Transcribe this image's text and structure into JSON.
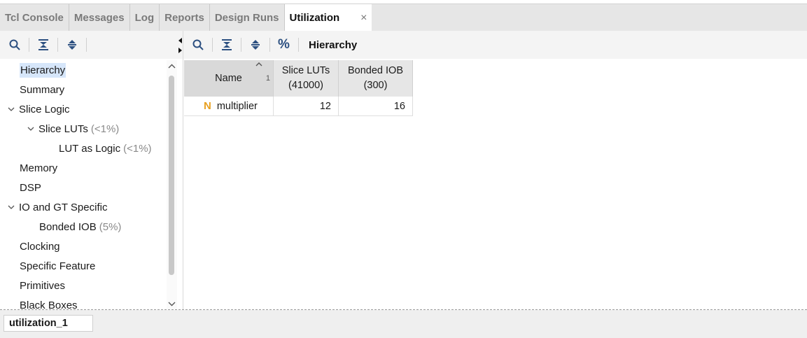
{
  "tabs": [
    {
      "label": "Tcl Console",
      "active": false
    },
    {
      "label": "Messages",
      "active": false
    },
    {
      "label": "Log",
      "active": false
    },
    {
      "label": "Reports",
      "active": false
    },
    {
      "label": "Design Runs",
      "active": false
    },
    {
      "label": "Utilization",
      "active": true
    }
  ],
  "tab_close_glyph": "×",
  "left_toolbar": {
    "icons": [
      "search-icon",
      "collapse-all-icon",
      "expand-all-icon"
    ]
  },
  "right_toolbar": {
    "icons": [
      "search-icon",
      "collapse-all-icon",
      "expand-all-icon",
      "percent-icon"
    ],
    "percent_glyph": "%",
    "title": "Hierarchy"
  },
  "tree": {
    "items": [
      {
        "label": "Hierarchy",
        "pct": "",
        "selected": true
      },
      {
        "label": "Summary",
        "pct": ""
      },
      {
        "label": "Slice Logic",
        "pct": "",
        "expanded": true
      },
      {
        "label": "Slice LUTs",
        "pct": "(<1%)",
        "expanded": true
      },
      {
        "label": "LUT as Logic",
        "pct": "(<1%)"
      },
      {
        "label": "Memory",
        "pct": ""
      },
      {
        "label": "DSP",
        "pct": ""
      },
      {
        "label": "IO and GT Specific",
        "pct": "",
        "expanded": true
      },
      {
        "label": "Bonded IOB",
        "pct": "(5%)"
      },
      {
        "label": "Clocking",
        "pct": ""
      },
      {
        "label": "Specific Feature",
        "pct": ""
      },
      {
        "label": "Primitives",
        "pct": ""
      },
      {
        "label": "Black Boxes",
        "pct": ""
      }
    ]
  },
  "table": {
    "columns": [
      {
        "line1": "Name",
        "line2": ""
      },
      {
        "line1": "Slice LUTs",
        "line2": "(41000)"
      },
      {
        "line1": "Bonded IOB",
        "line2": "(300)"
      }
    ],
    "sort_index": "1",
    "rows": [
      {
        "icon": "N",
        "name": "multiplier",
        "slice_luts": "12",
        "bonded_iob": "16"
      }
    ]
  },
  "colors": {
    "accent_icon": "#2b4f80",
    "selection": "#d6e6fa",
    "netlist_icon": "#e8a020"
  },
  "bottom": {
    "tab_label": "utilization_1"
  }
}
